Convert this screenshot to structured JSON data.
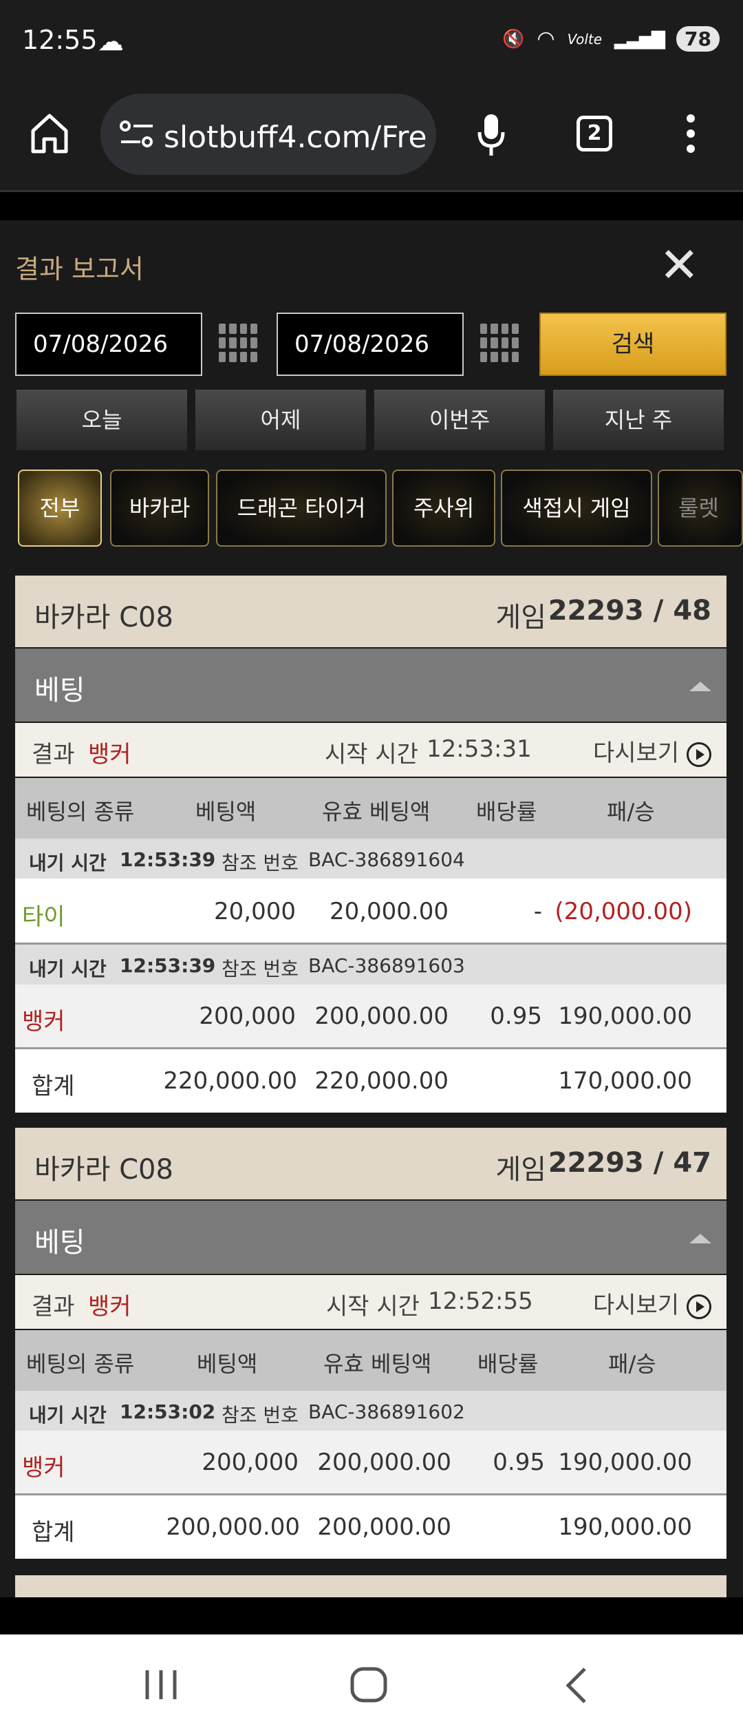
{
  "status_bar": {
    "time": "12:55",
    "battery": "78",
    "network": "Volte"
  },
  "browser": {
    "url": "slotbuff4.com/Fre",
    "tab_count": "2"
  },
  "panel": {
    "title": "결과 보고서",
    "date_from": "07/08/2026",
    "date_to": "07/08/2026",
    "search_label": "검색",
    "quick_ranges": [
      "오늘",
      "어제",
      "이번주",
      "지난 주"
    ],
    "categories": [
      "전부",
      "바카라",
      "드래곤 타이거",
      "주사위",
      "색접시 게임",
      "룰렛"
    ]
  },
  "columns": {
    "type": "베팅의 종류",
    "amount": "베팅액",
    "valid": "유효 베팅액",
    "odds": "배당률",
    "winloss": "패/승"
  },
  "labels": {
    "game": "게임",
    "betting": "베팅",
    "result": "결과",
    "start_time": "시작 시간",
    "replay": "다시보기",
    "bet_time": "내기 시간",
    "ref_no": "참조 번호",
    "total": "합계"
  },
  "games": [
    {
      "table": "바카라 C08",
      "game_no": "22293 / 48",
      "result": "뱅커",
      "start_time": "12:53:31",
      "bets": [
        {
          "time": "12:53:39",
          "ref": "BAC-386891604",
          "type": "타이",
          "amount": "20,000",
          "valid": "20,000.00",
          "odds": "-",
          "winloss": "(20,000.00)"
        },
        {
          "time": "12:53:39",
          "ref": "BAC-386891603",
          "type": "뱅커",
          "amount": "200,000",
          "valid": "200,000.00",
          "odds": "0.95",
          "winloss": "190,000.00"
        }
      ],
      "total": {
        "amount": "220,000.00",
        "valid": "220,000.00",
        "winloss": "170,000.00"
      }
    },
    {
      "table": "바카라 C08",
      "game_no": "22293 / 47",
      "result": "뱅커",
      "start_time": "12:52:55",
      "bets": [
        {
          "time": "12:53:02",
          "ref": "BAC-386891602",
          "type": "뱅커",
          "amount": "200,000",
          "valid": "200,000.00",
          "odds": "0.95",
          "winloss": "190,000.00"
        }
      ],
      "total": {
        "amount": "200,000.00",
        "valid": "200,000.00",
        "winloss": "190,000.00"
      }
    }
  ],
  "colors": {
    "accent_gold": "#e8b43a",
    "red": "#b3221f",
    "tie_green": "#6d9a2a"
  }
}
